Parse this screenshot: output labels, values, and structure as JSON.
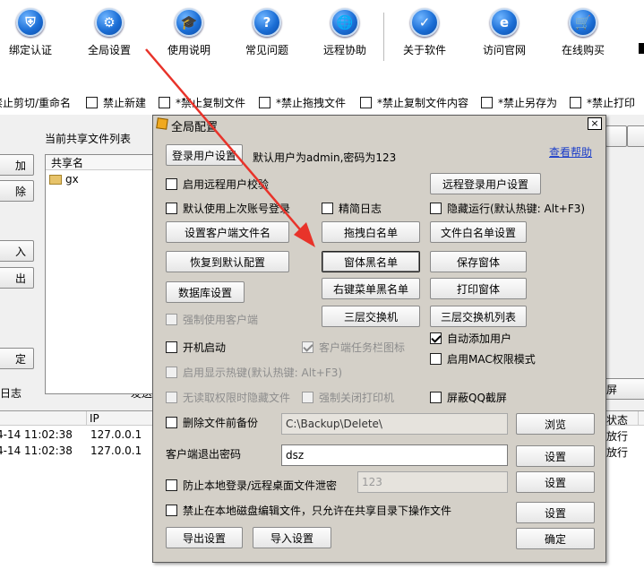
{
  "toolbar": {
    "items": [
      {
        "label": "绑定认证",
        "icon": "shield-icon",
        "glyph": "⛨"
      },
      {
        "label": "全局设置",
        "icon": "gear-icon",
        "glyph": "⚙"
      },
      {
        "label": "使用说明",
        "icon": "graduation-cap-icon",
        "glyph": "🎓"
      },
      {
        "label": "常见问题",
        "icon": "question-icon",
        "glyph": "?"
      },
      {
        "label": "远程协助",
        "icon": "globe-icon",
        "glyph": "🌐"
      },
      {
        "label": "关于软件",
        "icon": "about-icon",
        "glyph": "✓"
      },
      {
        "label": "访问官网",
        "icon": "ie-browser-icon",
        "glyph": "e"
      },
      {
        "label": "在线购买",
        "icon": "cart-icon",
        "glyph": "🛒"
      }
    ]
  },
  "options_bar": {
    "items": [
      {
        "label": "禁止剪切/重命名",
        "checked": false
      },
      {
        "label": "禁止新建",
        "checked": false
      },
      {
        "label": "*禁止复制文件",
        "checked": false
      },
      {
        "label": "*禁止拖拽文件",
        "checked": false
      },
      {
        "label": "*禁止复制文件内容",
        "checked": false
      },
      {
        "label": "*禁止另存为",
        "checked": false
      },
      {
        "label": "*禁止打印",
        "checked": false
      }
    ]
  },
  "main": {
    "shared_list_title": "当前共享文件列表",
    "left_buttons": [
      "加",
      "除",
      "入",
      "出",
      "定"
    ],
    "shared_column": "共享名",
    "shared_item": "gx",
    "log_label": "日志",
    "send_label": "发送",
    "right_screen": "屏",
    "log_columns": {
      "ip": "IP",
      "status": "状态"
    },
    "log_rows": [
      {
        "time": "4-14 11:02:38",
        "ip": "127.0.0.1",
        "status": "放行"
      },
      {
        "time": "4-14 11:02:38",
        "ip": "127.0.0.1",
        "status": "放行"
      }
    ]
  },
  "dialog": {
    "title": "全局配置",
    "close": "×",
    "login_user_btn": "登录用户设置",
    "default_user_text": "默认用户为admin,密码为123",
    "help_link": "查看帮助",
    "enable_remote_verify": "启用远程用户校验",
    "remote_login_btn": "远程登录用户设置",
    "default_last_account": "默认使用上次账号登录",
    "concise_log": "精简日志",
    "hide_run": "隐藏运行(默认热键: Alt+F3)",
    "client_filename_btn": "设置客户端文件名",
    "drag_whitelist_btn": "拖拽白名单",
    "file_whitelist_btn": "文件白名单设置",
    "restore_default_btn": "恢复到默认配置",
    "window_blacklist_btn": "窗体黑名单",
    "save_window_btn": "保存窗体",
    "db_settings_btn": "数据库设置",
    "context_blacklist_btn": "右键菜单黑名单",
    "print_window_btn": "打印窗体",
    "force_client": "强制使用客户端",
    "l3_switch_btn": "三层交换机",
    "l3_switch_list_btn": "三层交换机列表",
    "auto_start": "开机启动",
    "taskbar_icon": "客户端任务栏图标",
    "auto_add_user": "自动添加用户",
    "display_hotkey": "启用显示热键(默认热键: Alt+F3)",
    "mac_mode": "启用MAC权限模式",
    "hide_no_read": "无读取权限时隐藏文件",
    "force_close_printer": "强制关闭打印机",
    "block_qq": "屏蔽QQ截屏",
    "backup_before_delete": "删除文件前备份",
    "backup_path": "C:\\Backup\\Delete\\",
    "browse_btn": "浏览",
    "exit_password_label": "客户端退出密码",
    "exit_password": "dsz",
    "set_btn": "设置",
    "prevent_leak": "防止本地登录/远程桌面文件泄密",
    "leak_value": "123",
    "forbid_local_edit": "禁止在本地磁盘编辑文件，只允许在共享目录下操作文件",
    "export_btn": "导出设置",
    "import_btn": "导入设置",
    "ok_btn": "确定"
  },
  "colors": {
    "arrow": "#e8332a",
    "link": "#1a3dc9",
    "dialog_bg": "#d4d0c8"
  }
}
